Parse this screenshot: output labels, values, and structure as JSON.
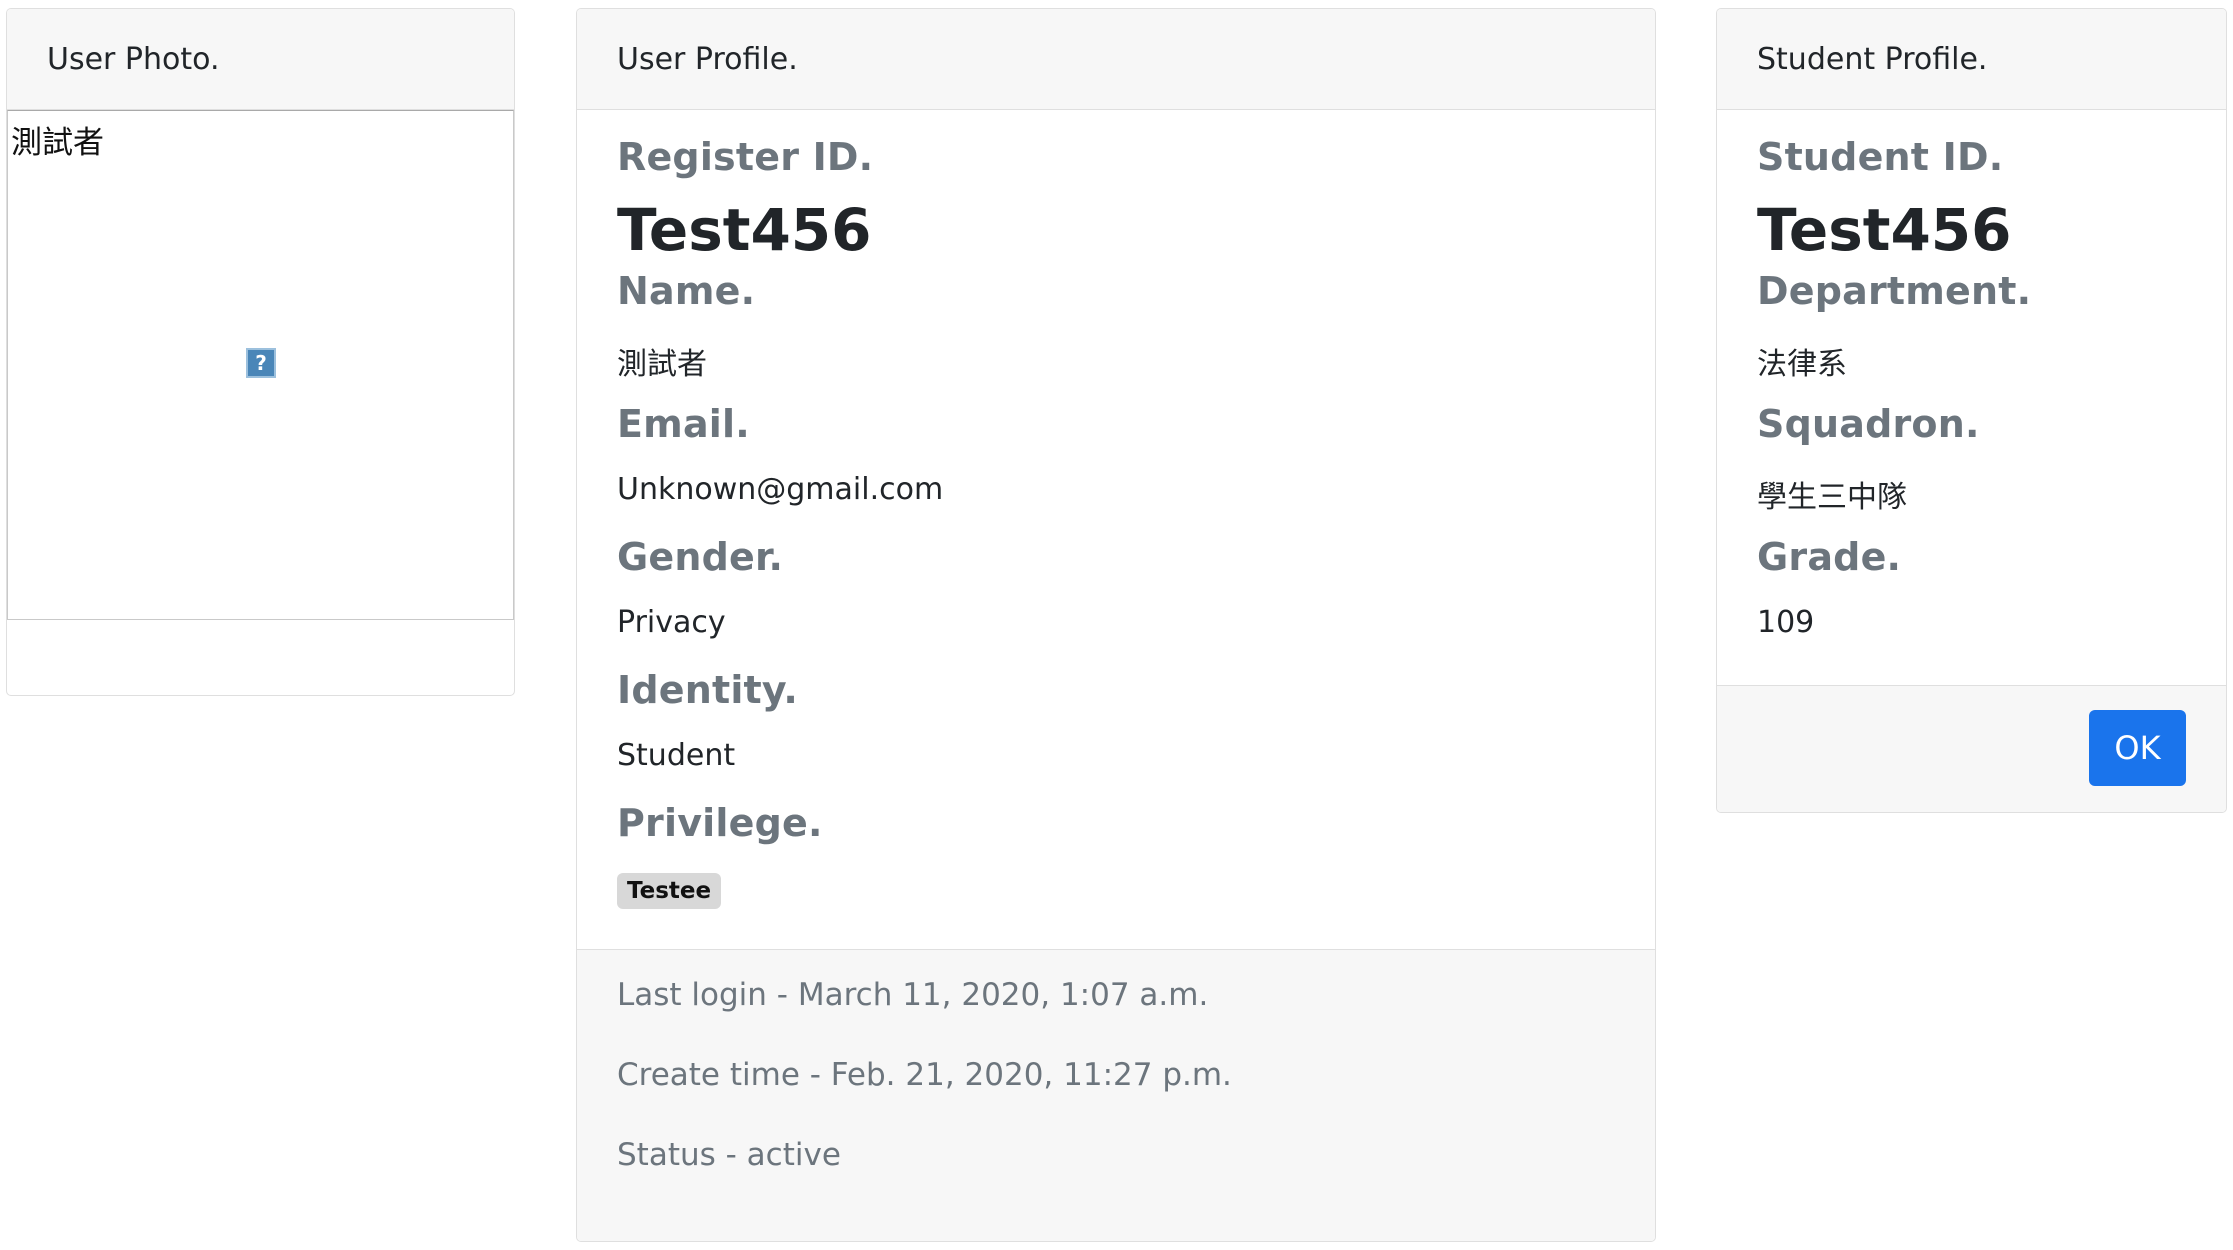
{
  "photo_card": {
    "header": "User Photo.",
    "alt_text": "測試者",
    "broken_icon_glyph": "?"
  },
  "profile_card": {
    "header": "User Profile.",
    "fields": {
      "register_id_label": "Register ID.",
      "register_id_value": "Test456",
      "name_label": "Name.",
      "name_value": "測試者",
      "email_label": "Email.",
      "email_value": "Unknown@gmail.com",
      "gender_label": "Gender.",
      "gender_value": "Privacy",
      "identity_label": "Identity.",
      "identity_value": "Student",
      "privilege_label": "Privilege.",
      "privilege_badge": "Testee"
    },
    "footer": {
      "last_login": "Last login - March 11, 2020, 1:07 a.m.",
      "create_time": "Create time - Feb. 21, 2020, 11:27 p.m.",
      "status": "Status - active"
    }
  },
  "student_card": {
    "header": "Student Profile.",
    "fields": {
      "student_id_label": "Student ID.",
      "student_id_value": "Test456",
      "department_label": "Department.",
      "department_value": "法律系",
      "squadron_label": "Squadron.",
      "squadron_value": "學生三中隊",
      "grade_label": "Grade.",
      "grade_value": "109"
    },
    "ok_button": "OK"
  },
  "colors": {
    "accent": "#1a74ec",
    "label_gray": "#6c757d",
    "header_bg": "#f7f7f7"
  }
}
